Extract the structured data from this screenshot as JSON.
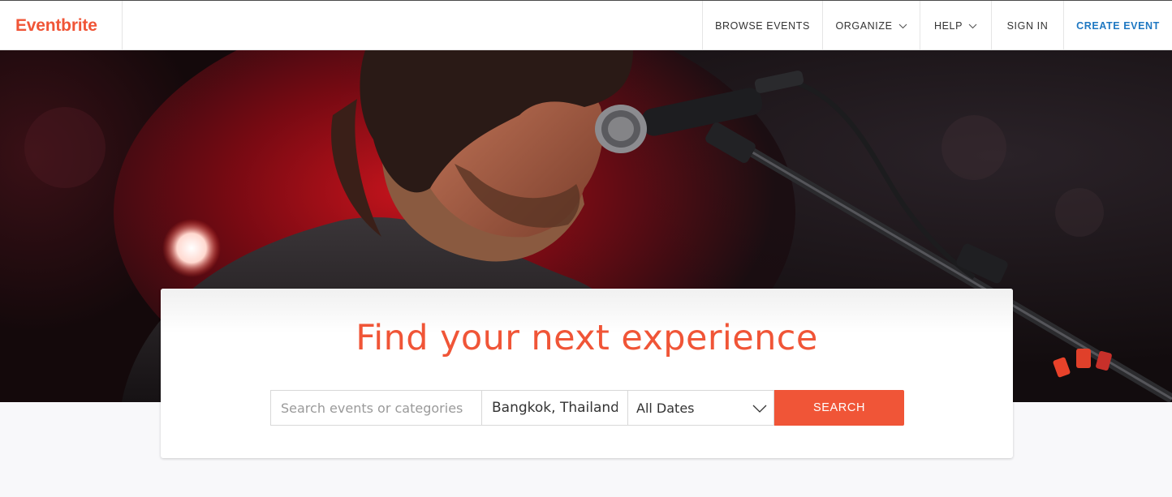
{
  "brand": {
    "logo_text": "Eventbrite",
    "color": "#f05537"
  },
  "nav": {
    "browse_events": "BROWSE EVENTS",
    "organize": "ORGANIZE",
    "help": "HELP",
    "sign_in": "SIGN IN",
    "create_event": "CREATE EVENT",
    "create_event_color": "#1f78c2"
  },
  "hero": {
    "image_subject": "singer performing at microphone on red-lit stage"
  },
  "search": {
    "headline": "Find your next experience",
    "query_placeholder": "Search events or categories",
    "location_value": "Bangkok, Thailand",
    "date_value": "All Dates",
    "button_label": "SEARCH"
  },
  "icons": {
    "dropdown": "chevron-down-icon"
  }
}
